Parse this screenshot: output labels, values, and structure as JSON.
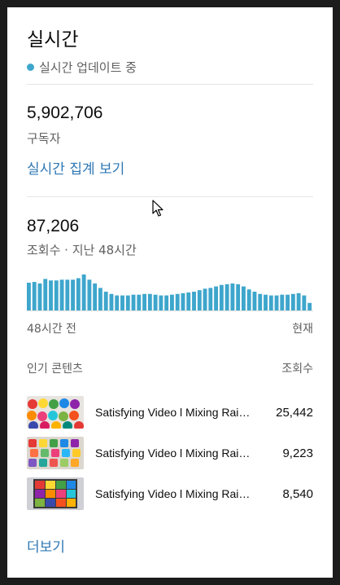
{
  "header": {
    "title": "실시간",
    "live_status": "실시간 업데이트 중"
  },
  "subscribers": {
    "count": "5,902,706",
    "label": "구독자",
    "link": "실시간 집계 보기"
  },
  "views": {
    "count": "87,206",
    "label": "조회수 · 지난 48시간"
  },
  "chart_data": {
    "type": "bar",
    "title": "",
    "x_start_label": "48시간 전",
    "x_end_label": "현재",
    "values": [
      74,
      76,
      72,
      84,
      80,
      80,
      82,
      82,
      82,
      86,
      96,
      82,
      72,
      60,
      50,
      44,
      40,
      40,
      40,
      42,
      42,
      44,
      44,
      42,
      40,
      40,
      42,
      44,
      46,
      48,
      50,
      54,
      58,
      60,
      64,
      68,
      70,
      72,
      70,
      64,
      56,
      50,
      44,
      42,
      40,
      40,
      42,
      42,
      44,
      46,
      40,
      20
    ],
    "color": "#3ea6cc",
    "ylim": [
      0,
      100
    ]
  },
  "top_content": {
    "header_left": "인기 콘텐츠",
    "header_right": "조회수",
    "items": [
      {
        "title": "Satisfying Video l Mixing Rainbow Playdoh Candy Cubes & Cutting",
        "views": "25,442"
      },
      {
        "title": "Satisfying Video l Mixing Rainbow Slime Jars",
        "views": "9,223"
      },
      {
        "title": "Satisfying Video l Mixing Rainbow Paint Pallet",
        "views": "8,540"
      }
    ]
  },
  "more_link": "더보기"
}
